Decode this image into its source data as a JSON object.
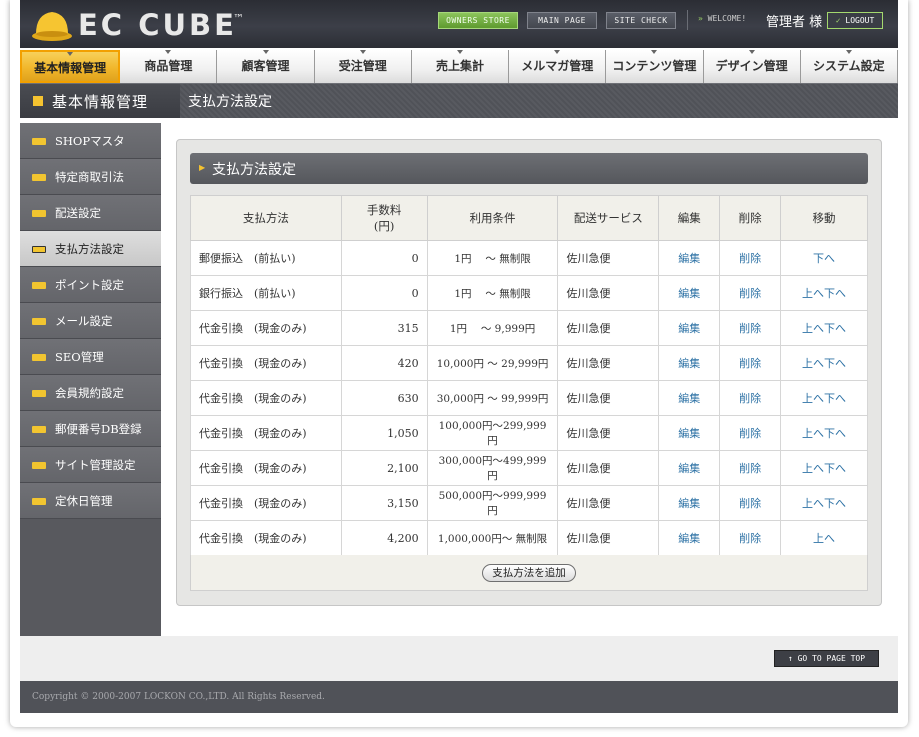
{
  "header": {
    "logo_text": "EC CUBE",
    "logo_tm": "™",
    "owners_store": "OWNERS STORE",
    "main_page": "MAIN PAGE",
    "site_check": "SITE CHECK",
    "welcome": "WELCOME!",
    "user_name": "管理者 様",
    "logout": "LOGOUT"
  },
  "nav": {
    "items": [
      "基本情報管理",
      "商品管理",
      "顧客管理",
      "受注管理",
      "売上集計",
      "メルマガ管理",
      "コンテンツ管理",
      "デザイン管理",
      "システム設定"
    ],
    "active_index": 0
  },
  "subheader": {
    "section_title": "基本情報管理",
    "page_title": "支払方法設定"
  },
  "sidebar": {
    "items": [
      "SHOPマスタ",
      "特定商取引法",
      "配送設定",
      "支払方法設定",
      "ポイント設定",
      "メール設定",
      "SEO管理",
      "会員規約設定",
      "郵便番号DB登録",
      "サイト管理設定",
      "定休日管理"
    ],
    "active_index": 3
  },
  "panel": {
    "title": "支払方法設定",
    "add_button": "支払方法を追加"
  },
  "table": {
    "headers": {
      "method": "支払方法",
      "fee_line1": "手数料",
      "fee_line2": "(円)",
      "condition": "利用条件",
      "delivery": "配送サービス",
      "edit": "編集",
      "delete": "削除",
      "move": "移動"
    },
    "rows": [
      {
        "method": "郵便振込　(前払い)",
        "fee": "0",
        "condition": "1円　 ～ 無制限",
        "delivery": "佐川急便",
        "edit": "編集",
        "delete": "削除",
        "up": "",
        "down": "下へ"
      },
      {
        "method": "銀行振込　(前払い)",
        "fee": "0",
        "condition": "1円　 ～ 無制限",
        "delivery": "佐川急便",
        "edit": "編集",
        "delete": "削除",
        "up": "上へ",
        "down": "下へ"
      },
      {
        "method": "代金引換　(現金のみ)",
        "fee": "315",
        "condition": "1円　 ～ 9,999円",
        "delivery": "佐川急便",
        "edit": "編集",
        "delete": "削除",
        "up": "上へ",
        "down": "下へ"
      },
      {
        "method": "代金引換　(現金のみ)",
        "fee": "420",
        "condition": "10,000円 ～ 29,999円",
        "delivery": "佐川急便",
        "edit": "編集",
        "delete": "削除",
        "up": "上へ",
        "down": "下へ"
      },
      {
        "method": "代金引換　(現金のみ)",
        "fee": "630",
        "condition": "30,000円 ～ 99,999円",
        "delivery": "佐川急便",
        "edit": "編集",
        "delete": "削除",
        "up": "上へ",
        "down": "下へ"
      },
      {
        "method": "代金引換　(現金のみ)",
        "fee": "1,050",
        "condition": "100,000円～299,999円",
        "delivery": "佐川急便",
        "edit": "編集",
        "delete": "削除",
        "up": "上へ",
        "down": "下へ"
      },
      {
        "method": "代金引換　(現金のみ)",
        "fee": "2,100",
        "condition": "300,000円～499,999円",
        "delivery": "佐川急便",
        "edit": "編集",
        "delete": "削除",
        "up": "上へ",
        "down": "下へ"
      },
      {
        "method": "代金引換　(現金のみ)",
        "fee": "3,150",
        "condition": "500,000円～999,999円",
        "delivery": "佐川急便",
        "edit": "編集",
        "delete": "削除",
        "up": "上へ",
        "down": "下へ"
      },
      {
        "method": "代金引換　(現金のみ)",
        "fee": "4,200",
        "condition": "1,000,000円～ 無制限",
        "delivery": "佐川急便",
        "edit": "編集",
        "delete": "削除",
        "up": "上へ",
        "down": ""
      }
    ]
  },
  "footer": {
    "page_top": "GO TO PAGE TOP",
    "copyright": "Copyright © 2000-2007 LOCKON CO.,LTD. All Rights Reserved."
  },
  "colors": {
    "accent": "#f2b62a",
    "link": "#2f73a6",
    "header_bg": "#2e3037"
  },
  "icons": [
    "cube-logo-icon",
    "chevron-right-icon",
    "checkmark-icon",
    "arrow-up-icon",
    "folder-icon",
    "square-bullet-icon"
  ]
}
